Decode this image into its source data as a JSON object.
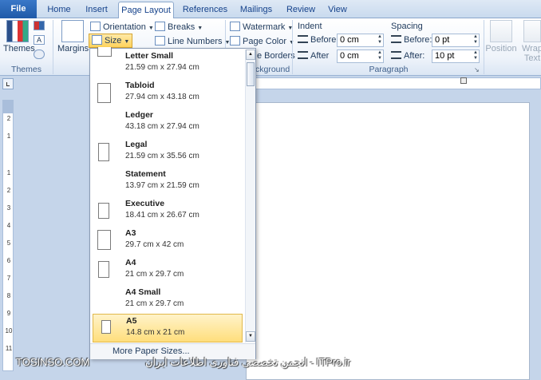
{
  "tabs": [
    "File",
    "Home",
    "Insert",
    "Page Layout",
    "References",
    "Mailings",
    "Review",
    "View"
  ],
  "ribbon": {
    "themes_label": "Themes",
    "themes_group": "Themes",
    "margins_label": "Margins",
    "orientation_label": "Orientation",
    "size_label": "Size",
    "breaks_label": "Breaks",
    "line_numbers_label": "Line Numbers",
    "watermark_label": "Watermark",
    "page_color_label": "Page Color",
    "page_borders_label": "e Borders",
    "background_group": "ckground",
    "indent_label": "Indent",
    "before_label": "Before",
    "after_label": "After",
    "indent_before_value": "0 cm",
    "indent_after_value": "0 cm",
    "spacing_label": "Spacing",
    "spacing_before_label": "Before:",
    "spacing_after_label": "After:",
    "spacing_before_value": "0 pt",
    "spacing_after_value": "10 pt",
    "paragraph_group": "Paragraph",
    "position_label": "Position",
    "wrap_text_label": "Wrap Text"
  },
  "size_menu": {
    "items": [
      {
        "name": "Letter Small",
        "dims": "21.59 cm x 27.94 cm",
        "orientation": "portrait"
      },
      {
        "name": "Tabloid",
        "dims": "27.94 cm x 43.18 cm",
        "orientation": "portrait"
      },
      {
        "name": "Ledger",
        "dims": "43.18 cm x 27.94 cm",
        "orientation": "landscape"
      },
      {
        "name": "Legal",
        "dims": "21.59 cm x 35.56 cm",
        "orientation": "portrait"
      },
      {
        "name": "Statement",
        "dims": "13.97 cm x 21.59 cm",
        "orientation": "portrait"
      },
      {
        "name": "Executive",
        "dims": "18.41 cm x 26.67 cm",
        "orientation": "portrait"
      },
      {
        "name": "A3",
        "dims": "29.7 cm x 42 cm",
        "orientation": "portrait"
      },
      {
        "name": "A4",
        "dims": "21 cm x 29.7 cm",
        "orientation": "portrait"
      },
      {
        "name": "A4 Small",
        "dims": "21 cm x 29.7 cm",
        "orientation": "portrait"
      },
      {
        "name": "A5",
        "dims": "14.8 cm x 21 cm",
        "orientation": "portrait",
        "selected": true
      }
    ],
    "more_label": "More Paper Sizes..."
  },
  "ruler_numbers": [
    "2",
    "1",
    "1",
    "2",
    "3",
    "4",
    "5",
    "6",
    "7",
    "8",
    "9",
    "10",
    "11"
  ],
  "watermark_left": "TOSINSO.COM",
  "watermark_right": "انجمن تخصصی فناوری اطلاعات ایران - ITPro.ir",
  "colors": {
    "accent": "#1f5aa8",
    "highlight": "#ffd35c",
    "ribbon_bg": "#eef3fa"
  }
}
